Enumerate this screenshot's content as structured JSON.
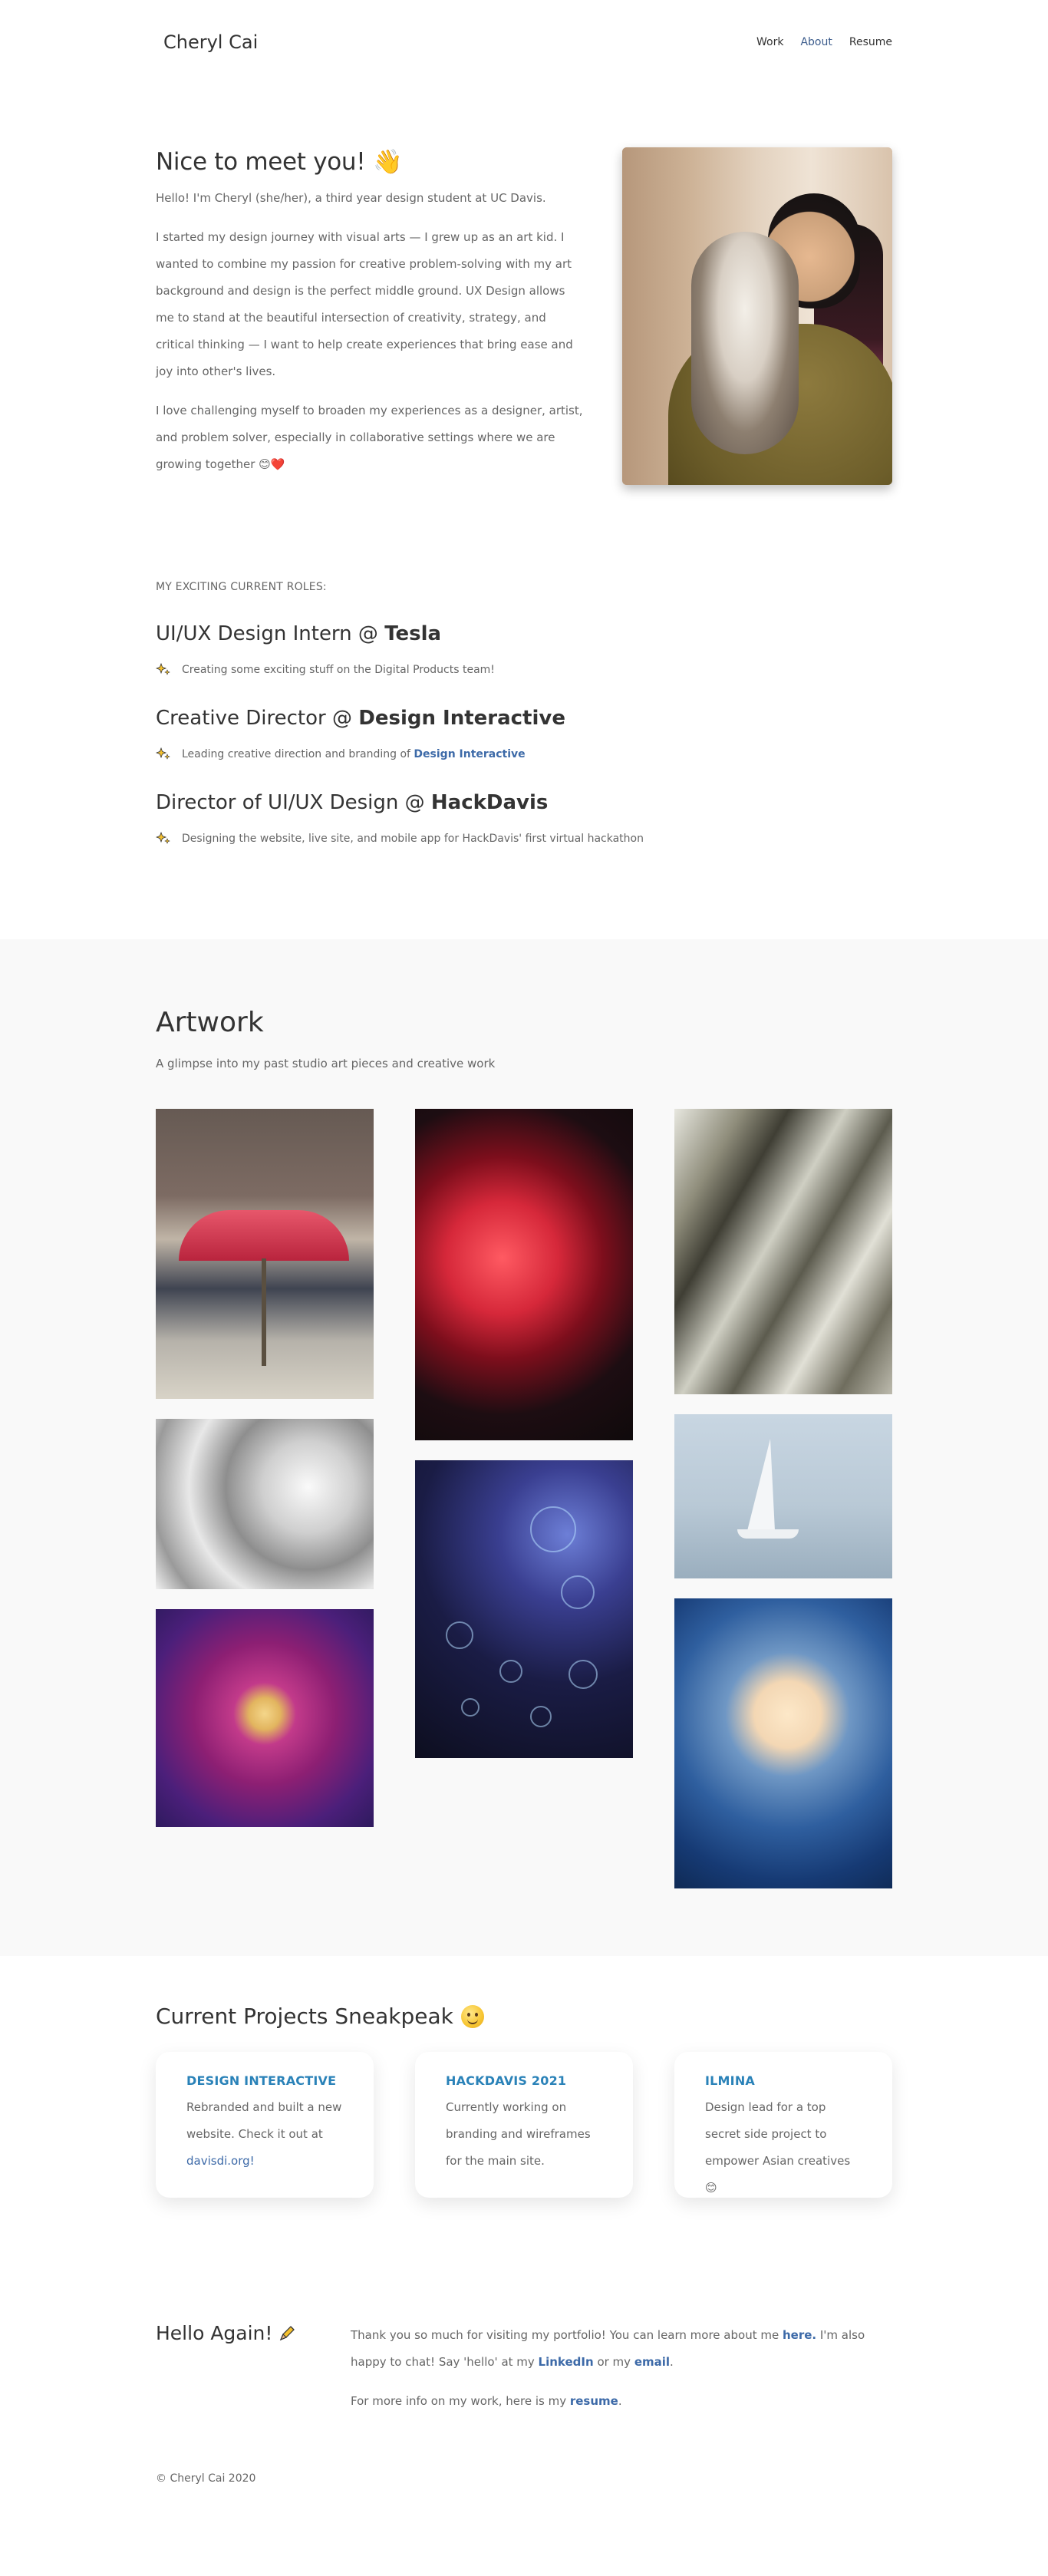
{
  "header": {
    "brand": "Cheryl Cai",
    "nav": {
      "work": "Work",
      "about": "About",
      "resume": "Resume"
    }
  },
  "intro": {
    "heading": "Nice to meet you! 👋",
    "p1": "Hello! I'm Cheryl (she/her), a third year design student at UC Davis.",
    "p2": "I started my design journey with visual arts — I grew up as an art kid. I wanted to combine my passion for creative problem-solving with my art background and design is the perfect middle ground. UX Design allows me to stand at the beautiful intersection of creativity, strategy, and critical thinking — I want to help create experiences that bring ease and joy into other's lives.",
    "p3": "I love challenging myself to broaden my experiences as a designer, artist, and problem solver, especially in collaborative settings where we are growing together 😊❤️"
  },
  "roles": {
    "label": "MY EXCITING CURRENT ROLES:",
    "items": [
      {
        "title": "UI/UX Design Intern @ ",
        "org": "Tesla",
        "desc": "Creating some exciting stuff on the Digital Products team!"
      },
      {
        "title": "Creative Director @ ",
        "org": "Design Interactive",
        "desc_pre": "Leading creative direction and branding of ",
        "desc_link": "Design Interactive"
      },
      {
        "title": "Director of UI/UX Design @ ",
        "org": "HackDavis",
        "desc": "Designing the website, live site, and mobile app for HackDavis' first virtual hackathon"
      }
    ]
  },
  "artwork": {
    "title": "Artwork",
    "subtitle": "A glimpse into my past studio art pieces and creative work"
  },
  "projects": {
    "title": "Current Projects Sneakpeak",
    "cards": [
      {
        "title": "DESIGN INTERACTIVE",
        "text": "Rebranded and built a new website. Check it out at ",
        "link": "davisdi.org!"
      },
      {
        "title": "HACKDAVIS 2021",
        "text": "Currently working on branding and wireframes for the main site."
      },
      {
        "title": "ILMINA",
        "text": "Design lead for a top secret side project to empower Asian creatives 😊"
      }
    ]
  },
  "hello": {
    "title": "Hello Again!",
    "p1_a": "Thank you so much for visiting my portfolio! You can learn more about me ",
    "p1_link1": "here.",
    "p1_b": " I'm also happy to chat! Say 'hello' at my ",
    "p1_link2": "LinkedIn",
    "p1_c": " or my ",
    "p1_link3": "email",
    "p1_d": ".",
    "p2_a": "For more info on my work, here is my ",
    "p2_link": "resume",
    "p2_b": "."
  },
  "footer": {
    "copyright": "© Cheryl Cai 2020"
  },
  "colors": {
    "accent": "#3d6aa8",
    "card_title": "#2a82b8",
    "section_bg": "#f9f9f9"
  }
}
